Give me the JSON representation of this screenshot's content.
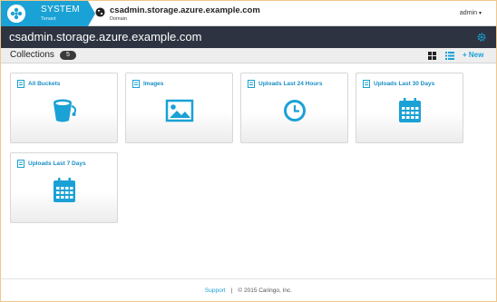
{
  "header": {
    "system_label": "SYSTEM",
    "tenant_label": "Tenant",
    "domain_name": "csadmin.storage.azure.example.com",
    "domain_sub": "Domain",
    "user_label": "admin",
    "brand_color": "#1aa1d6"
  },
  "titlebar": {
    "title": "csadmin.storage.azure.example.com",
    "settings_icon": "gear-icon"
  },
  "collections": {
    "label": "Collections",
    "count": "5",
    "new_label": "+ New",
    "grid_view_icon": "grid-view-icon",
    "list_view_icon": "list-view-icon"
  },
  "cards": [
    {
      "title": "All Buckets",
      "icon": "bucket-icon"
    },
    {
      "title": "Images",
      "icon": "image-icon"
    },
    {
      "title": "Uploads Last 24 Hours",
      "icon": "clock-icon"
    },
    {
      "title": "Uploads Last 30 Days",
      "icon": "calendar-icon"
    },
    {
      "title": "Uploads Last 7 Days",
      "icon": "calendar-icon"
    }
  ],
  "footer": {
    "support_label": "Support",
    "separator": "|",
    "copyright": "© 2015 Caringo, Inc."
  }
}
